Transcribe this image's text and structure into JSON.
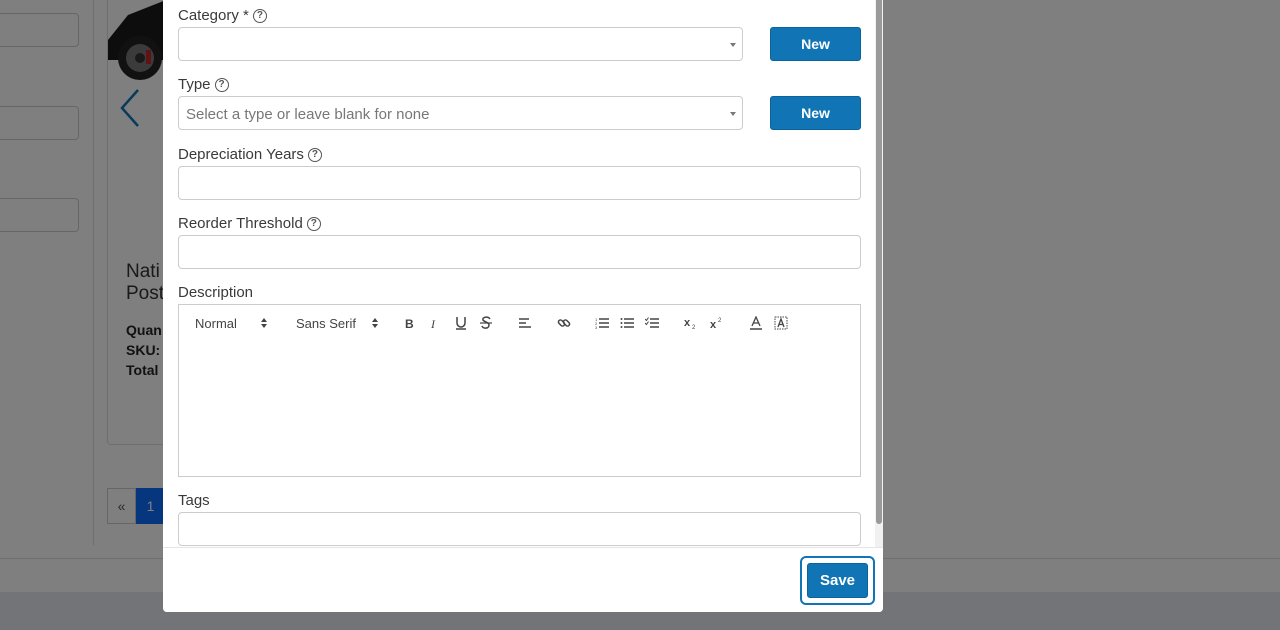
{
  "background": {
    "product_title_line1": "Nati",
    "product_title_line2": "Post",
    "meta_quantity": "Quan",
    "meta_sku": "SKU: s",
    "meta_total": "Total",
    "pager_prev": "«",
    "pager_current": "1"
  },
  "form": {
    "category": {
      "label": "Category *",
      "help_glyph": "?",
      "value": "",
      "new_label": "New"
    },
    "type": {
      "label": "Type",
      "help_glyph": "?",
      "placeholder": "Select a type or leave blank for none",
      "new_label": "New"
    },
    "depreciation": {
      "label": "Depreciation Years",
      "help_glyph": "?",
      "value": ""
    },
    "reorder": {
      "label": "Reorder Threshold",
      "help_glyph": "?",
      "value": ""
    },
    "description": {
      "label": "Description",
      "toolbar": {
        "header_select": "Normal",
        "font_select": "Sans Serif",
        "icons": [
          "bold-icon",
          "italic-icon",
          "underline-icon",
          "strike-icon",
          "align-icon",
          "link-icon",
          "ordered-list-icon",
          "bullet-list-icon",
          "check-list-icon",
          "subscript-icon",
          "superscript-icon",
          "text-color-icon",
          "background-color-icon"
        ]
      },
      "content": ""
    },
    "tags": {
      "label": "Tags",
      "value": ""
    }
  },
  "footer": {
    "save_label": "Save"
  },
  "colors": {
    "primary": "#1175b5",
    "overlay": "#808080"
  }
}
